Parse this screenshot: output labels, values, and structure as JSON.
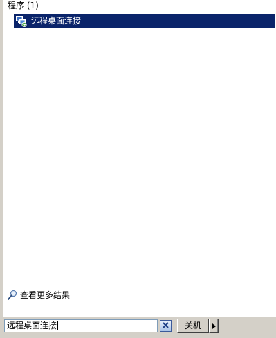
{
  "results": {
    "group_title": "程序 (1)",
    "items": [
      {
        "label": "远程桌面连接",
        "icon": "remote-desktop-icon",
        "selected": true
      }
    ],
    "more_results_label": "查看更多结果",
    "more_results_icon": "magnifier-icon"
  },
  "search": {
    "value": "远程桌面连接",
    "clear_icon": "clear-x-icon"
  },
  "shutdown": {
    "label": "关机",
    "arrow_icon": "triangle-right-icon"
  },
  "colors": {
    "selection": "#0a246a",
    "bar_background": "#d4d0c8"
  }
}
